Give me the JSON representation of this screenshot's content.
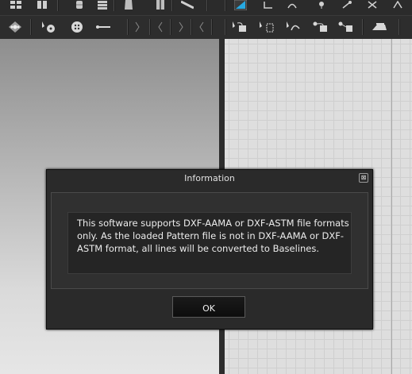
{
  "toolbar_top": {
    "icons": [
      "grid-icon",
      "book-icon",
      "spool-icon",
      "spool-stack-icon",
      "garment-icon",
      "shirt-icon",
      "ruler-icon",
      "dimension-icon",
      "corner-icon",
      "tool-icon",
      "tool-icon-2",
      "tool-icon-3",
      "tool-icon-4"
    ]
  },
  "toolbar_second": {
    "icons": [
      "node-icon",
      "point-select-icon",
      "button-icon",
      "line-icon",
      "notch-icon",
      "notch-icon-2",
      "notch-icon-3",
      "notch-icon-4",
      "arrow-point-icon",
      "arrow-point-icon-2",
      "curve-arrow-icon",
      "arrow-point-icon-3",
      "arrow-point-icon-4",
      "arrow-point-icon-5",
      "iron-icon"
    ]
  },
  "dialog": {
    "title": "Information",
    "close_glyph": "⊠",
    "message": "This software supports DXF-AAMA or DXF-ASTM file formats only. As the loaded Pattern file is not in DXF-AAMA or DXF-ASTM format, all lines will be converted to Baselines.",
    "ok_label": "OK"
  },
  "colors": {
    "toolbar": "#2b2b2b",
    "dialog_bg": "#2a2a2a",
    "accent_blue": "#27a9e1"
  }
}
